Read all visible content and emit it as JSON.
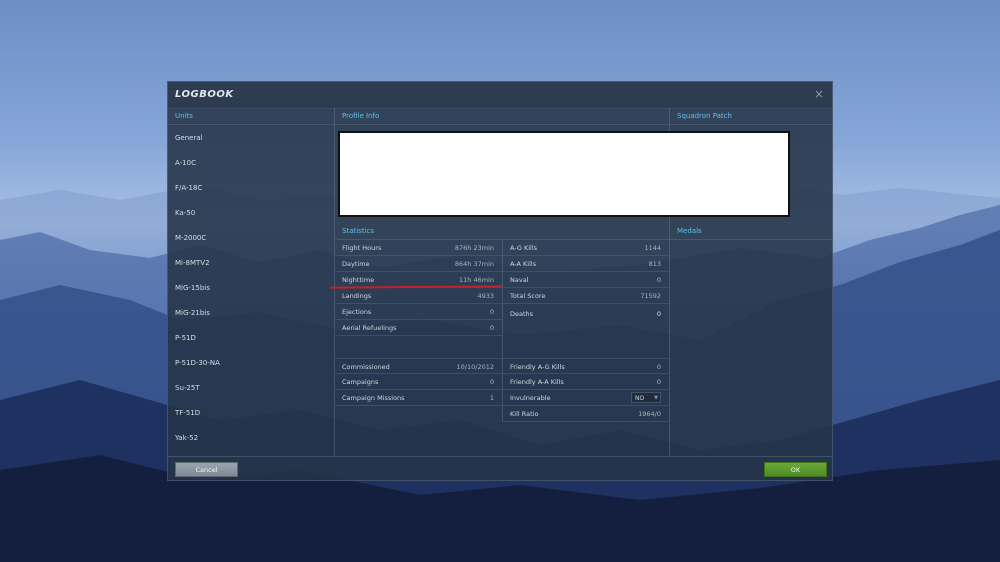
{
  "dialog": {
    "title": "LOGBOOK",
    "close_glyph": "×"
  },
  "units": {
    "header": "Units",
    "items": [
      "General",
      "A-10C",
      "F/A-18C",
      "Ka-50",
      "M-2000C",
      "Mi-8MTV2",
      "MiG-15bis",
      "MiG-21bis",
      "P-51D",
      "P-51D-30-NA",
      "Su-25T",
      "TF-51D",
      "Yak-52"
    ]
  },
  "profile": {
    "header": "Profile Info"
  },
  "squadron": {
    "header": "Squadron Patch"
  },
  "statistics": {
    "header": "Statistics",
    "left": [
      {
        "label": "Flight Hours",
        "value": "876h 23min"
      },
      {
        "label": "Daytime",
        "value": "864h 37min"
      },
      {
        "label": "Nighttime",
        "value": "11h 46min"
      },
      {
        "label": "Landings",
        "value": "4933"
      },
      {
        "label": "Ejections",
        "value": "0"
      },
      {
        "label": "Aerial Refuelings",
        "value": "0"
      }
    ],
    "right": [
      {
        "label": "A-G Kills",
        "value": "1144"
      },
      {
        "label": "A-A Kills",
        "value": "813"
      },
      {
        "label": "Naval",
        "value": "0"
      },
      {
        "label": "Total Score",
        "value": "71592"
      },
      {
        "label": "Deaths",
        "value": "0"
      }
    ],
    "left2": [
      {
        "label": "Commissioned",
        "value": "10/10/2012"
      },
      {
        "label": "Campaigns",
        "value": "0"
      },
      {
        "label": "Campaign Missions",
        "value": "1"
      }
    ],
    "right2": [
      {
        "label": "Friendly A-G Kills",
        "value": "0"
      },
      {
        "label": "Friendly A-A Kills",
        "value": "0"
      },
      {
        "label": "Invulnerable",
        "value": "NO"
      },
      {
        "label": "Kill Ratio",
        "value": "1964/0"
      }
    ]
  },
  "medals": {
    "header": "Medals"
  },
  "buttons": {
    "cancel": "Cancel",
    "ok": "OK"
  },
  "colors": {
    "accent": "#5ec0ea",
    "ok_green": "#5a9a30",
    "annotation_red": "#c8202a"
  }
}
